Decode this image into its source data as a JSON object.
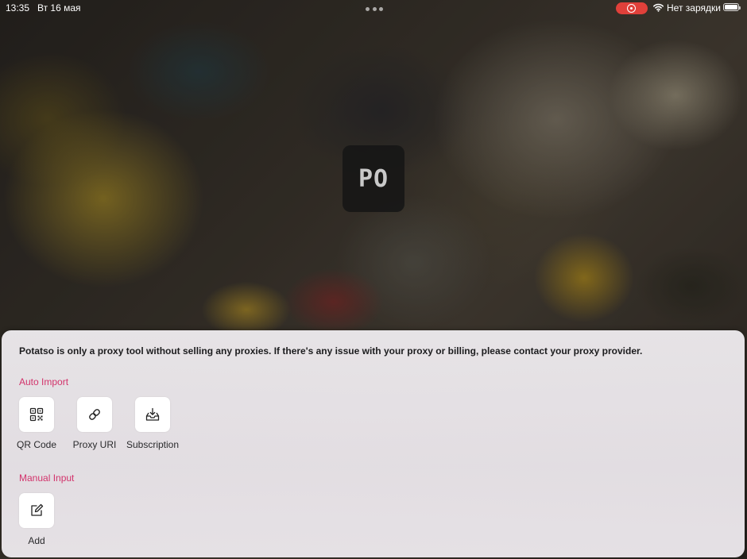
{
  "status_bar": {
    "time": "13:35",
    "date": "Вт 16 мая",
    "charging": "Нет зарядки",
    "record_color": "#e0403a"
  },
  "app": {
    "logo_text": "PO"
  },
  "sheet": {
    "notice": "Potatso is only a proxy tool without selling any proxies. If there's any issue with your proxy or billing, please contact your proxy provider.",
    "accent_color": "#d2336b",
    "auto_import": {
      "title": "Auto Import",
      "items": [
        {
          "label": "QR Code",
          "icon": "qr-code-icon"
        },
        {
          "label": "Proxy URI",
          "icon": "link-icon"
        },
        {
          "label": "Subscription",
          "icon": "inbox-download-icon"
        }
      ]
    },
    "manual_input": {
      "title": "Manual Input",
      "items": [
        {
          "label": "Add",
          "icon": "edit-icon"
        }
      ]
    }
  }
}
